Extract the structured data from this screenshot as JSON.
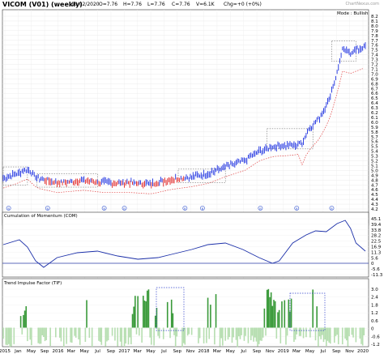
{
  "header": {
    "title": "VICOM (V01) (weekly)",
    "date": "10/02/2020",
    "open": "O=7.76",
    "high": "H=7.76",
    "low": "L=7.76",
    "close": "C=7.76",
    "volume": "V=6.1K",
    "change": "Chg=+0 (+0%)",
    "watermark": "ChartNexus.com"
  },
  "price_panel": {
    "mode_label": "Mode : Bullish",
    "y_labels": [
      "8.2",
      "8.1",
      "8.0",
      "7.9",
      "7.8",
      "7.7",
      "7.6",
      "7.5",
      "7.4",
      "7.3",
      "7.2",
      "7.1",
      "7.0",
      "6.9",
      "6.8",
      "6.7",
      "6.6",
      "6.5",
      "6.4",
      "6.3",
      "6.2",
      "6.1",
      "6.0",
      "5.9",
      "5.8",
      "5.7",
      "5.6",
      "5.5",
      "5.4",
      "5.3",
      "5.2",
      "5.1",
      "5.0",
      "4.9",
      "4.8",
      "4.7",
      "4.6",
      "4.5",
      "4.4",
      "4.3",
      "4.2"
    ],
    "marker_symbol": "B",
    "colors": {
      "up": "#1a2ee0",
      "down": "#e02020",
      "trail": "#e04040",
      "box": "#555555",
      "dip": "#2060d0"
    }
  },
  "com_panel": {
    "title": "Cumulation of Momentum (COM)",
    "y_labels": [
      "45.1",
      "39.4",
      "33.8",
      "28.2",
      "22.5",
      "16.9",
      "11.3",
      "5.6",
      "0",
      "-5.6",
      "-11.3"
    ],
    "colors": {
      "line": "#1a2ea8",
      "zero": "#2a3aa8"
    }
  },
  "tif_panel": {
    "title": "Trend Impulse Factor (TIF)",
    "y_labels": [
      "3.0",
      "2.4",
      "1.8",
      "1.2",
      "0.6",
      "0",
      "-0.6",
      "-1.2"
    ],
    "colors": {
      "pos": "#3a9a3a",
      "neg": "#b6deb0",
      "box": "#3344cc"
    }
  },
  "x_axis": {
    "labels": [
      "2015",
      "Jan",
      "May",
      "Sep",
      "2016",
      "Mar",
      "May",
      "Jul",
      "Sep",
      "2017",
      "Mar",
      "May",
      "Jul",
      "Sep",
      "Nov",
      "2018",
      "Mar",
      "May",
      "Jul",
      "Sep",
      "Nov",
      "2019",
      "Mar",
      "May",
      "Jul",
      "Sep",
      "Nov",
      "2020"
    ]
  }
}
